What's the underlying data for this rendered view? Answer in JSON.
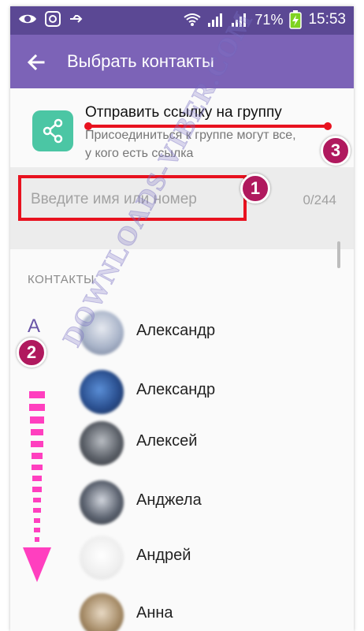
{
  "status_bar": {
    "battery_percent": "71%",
    "time": "15:53"
  },
  "toolbar": {
    "title": "Выбрать контакты",
    "background": "#7c63b7"
  },
  "share_link": {
    "title": "Отправить ссылку на группу",
    "subtitle": "Присоединиться к группе могут все, у кого есть ссылка",
    "icon": "share-icon",
    "icon_color": "#4bc6a4"
  },
  "search": {
    "placeholder": "Введите имя или номер",
    "counter": "0/244"
  },
  "contacts": {
    "section_header": "КОНТАКТЫ",
    "index_letter": "А",
    "items": [
      {
        "name": "Александр"
      },
      {
        "name": "Александр"
      },
      {
        "name": "Алексей"
      },
      {
        "name": "Анджела"
      },
      {
        "name": "Андрей"
      },
      {
        "name": "Анна"
      }
    ]
  },
  "annotations": {
    "badges": [
      "1",
      "2",
      "3"
    ],
    "watermark": "DOWNLOADS-VIBER.COM",
    "highlight_color": "#e8121f",
    "arrow_color": "#ff3fbf"
  }
}
